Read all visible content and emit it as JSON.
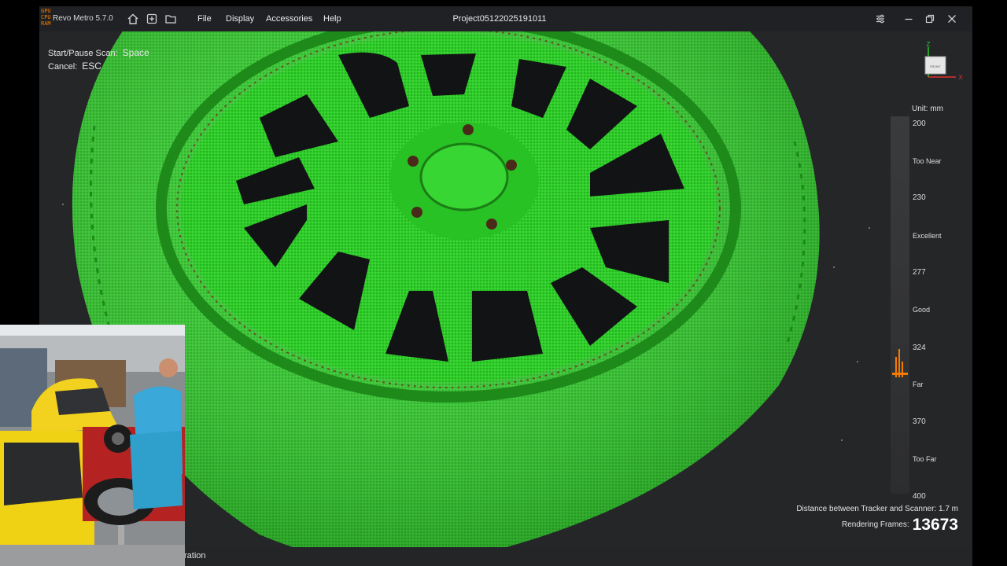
{
  "titlebar": {
    "stats": [
      "GPU",
      "CPU",
      "RAM"
    ],
    "app_title": "Revo Metro 5.7.0",
    "menus": [
      "File",
      "Display",
      "Accessories",
      "Help"
    ],
    "project": "Project05122025191011"
  },
  "hints": {
    "start_label": "Start/Pause Scan:",
    "start_key": "Space",
    "cancel_label": "Cancel:",
    "cancel_key": "ESC"
  },
  "axis": {
    "z": "Z",
    "x": "X",
    "front": "FRONT"
  },
  "scale": {
    "unit": "Unit: mm",
    "labels": [
      "200",
      "Too Near",
      "230",
      "Excellent",
      "277",
      "Good",
      "324",
      "Far",
      "370",
      "Too Far",
      "400"
    ]
  },
  "footer": {
    "distance": "Distance between Tracker and Scanner: 1.7 m",
    "frames_label": "Rendering Frames:",
    "frames_value": "13673"
  },
  "status": {
    "text": "ration"
  },
  "colors": {
    "scan_green": "#2fd12a",
    "background": "#252628",
    "accent_orange": "#f57c00"
  }
}
